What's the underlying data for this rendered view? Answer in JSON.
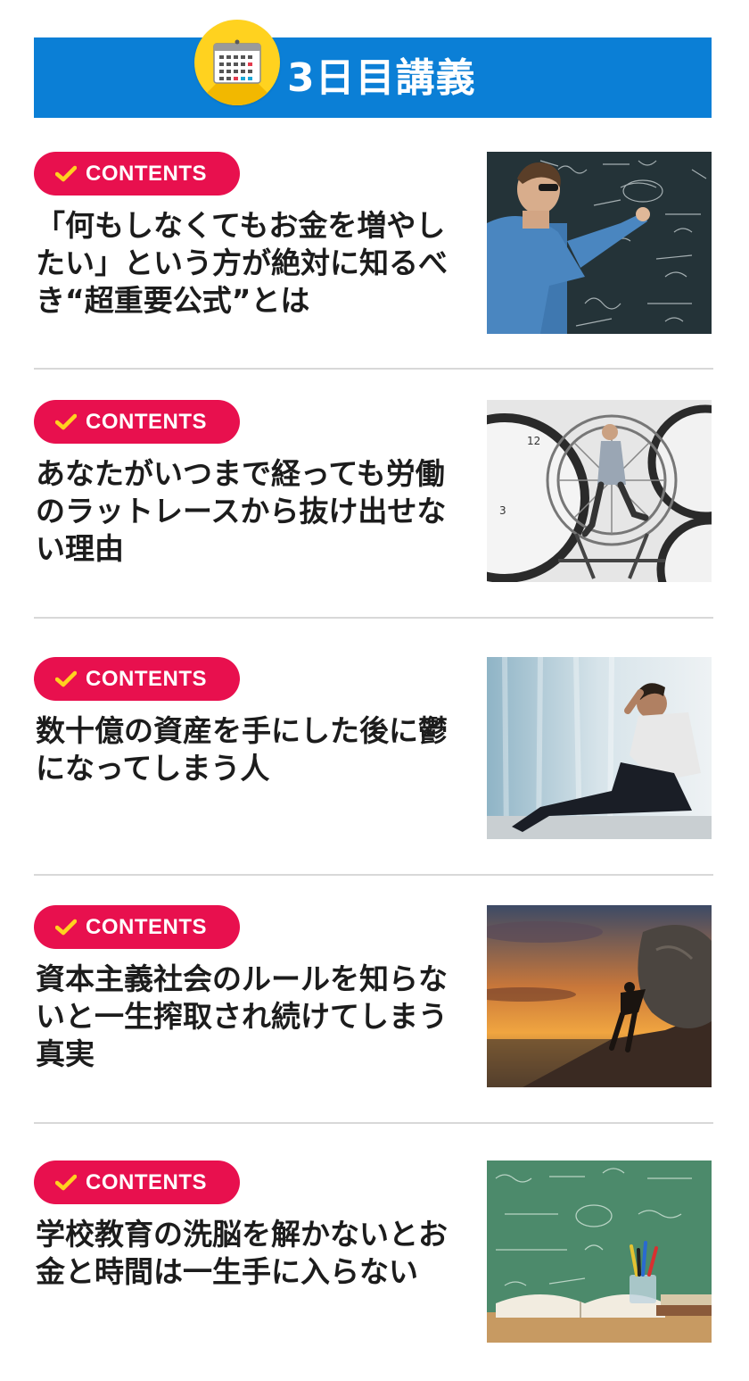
{
  "header": {
    "title": "3日目講義",
    "icon": "calendar-icon",
    "colors": {
      "bar": "#0b7fd6",
      "badge": "#ffd21f"
    }
  },
  "badge_label": "CONTENTS",
  "colors": {
    "pill": "#e8104e",
    "check": "#ffd21f",
    "title_text": "#1c1c1c"
  },
  "items": [
    {
      "title": "「何もしなくてもお金を増やしたい」という方が絶対に知るべき“超重要公式”とは",
      "image": "man-writing-equations-on-chalkboard"
    },
    {
      "title": "あなたがいつまで経っても労働のラットレースから抜け出せない理由",
      "image": "businessman-running-in-hamster-wheel-among-clocks"
    },
    {
      "title": "数十億の資産を手にした後に鬱になってしまう人",
      "image": "depressed-man-sitting-by-window"
    },
    {
      "title": "資本主義社会のルールを知らないと一生搾取され続けてしまう真実",
      "image": "man-pushing-boulder-up-hill-at-sunset"
    },
    {
      "title": "学校教育の洗脳を解かないとお金と時間は一生手に入らない",
      "image": "books-and-pencils-before-green-chalkboard"
    }
  ]
}
